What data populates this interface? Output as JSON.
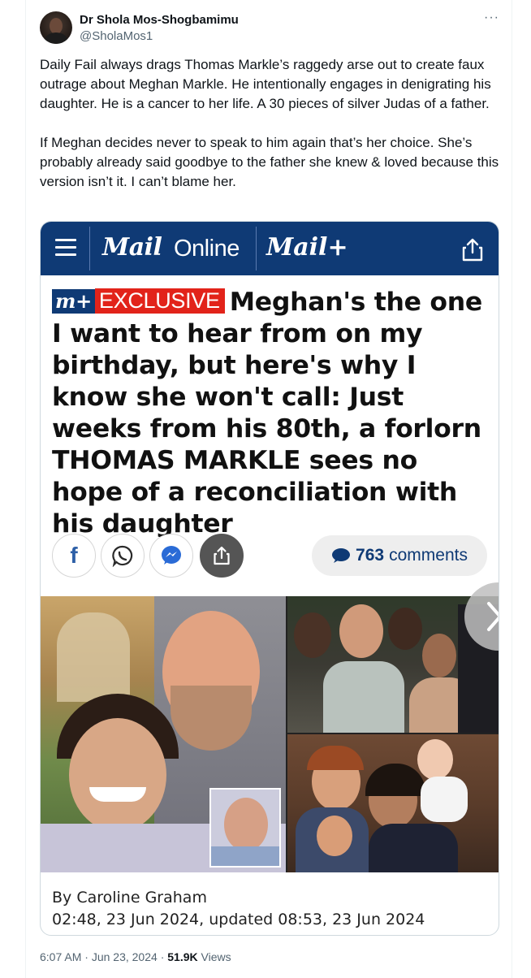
{
  "tweet": {
    "author_name": "Dr Shola Mos-Shogbamimu",
    "author_handle": "@SholaMos1",
    "paragraphs": [
      "Daily Fail always drags Thomas Markle’s raggedy arse out to create faux outrage about Meghan Markle. He intentionally engages in denigrating his daughter. He is a cancer to her life. A 30 pieces of silver Judas of a father.",
      "If Meghan decides never to speak to him again that’s her choice. She’s probably already said goodbye to the father she knew & loved because this version isn’t it. I can’t blame her."
    ],
    "time": "6:07 AM",
    "date": "Jun 23, 2024",
    "views_count": "51.9K",
    "views_label": "Views",
    "more_icon": "more-horizontal-icon"
  },
  "embed": {
    "logo_mail": "Mail",
    "logo_online": "Online",
    "logo_mailplus": "Mail+",
    "badge_mplus": "m+",
    "badge_exclusive": "EXCLUSIVE",
    "headline": "Meghan's the one I want to hear from on my birthday, but here's why I know she won't call: Just weeks from his 80th, a forlorn THOMAS MARKLE sees no hope of a reconciliation with his daughter",
    "comments_count": "763",
    "comments_label": "comments",
    "byline_author": "By Caroline Graham",
    "byline_time": "02:48, 23 Jun 2024, updated 08:53, 23 Jun 2024",
    "brand_color": "#0f3a75",
    "exclusive_color": "#e2231a"
  }
}
